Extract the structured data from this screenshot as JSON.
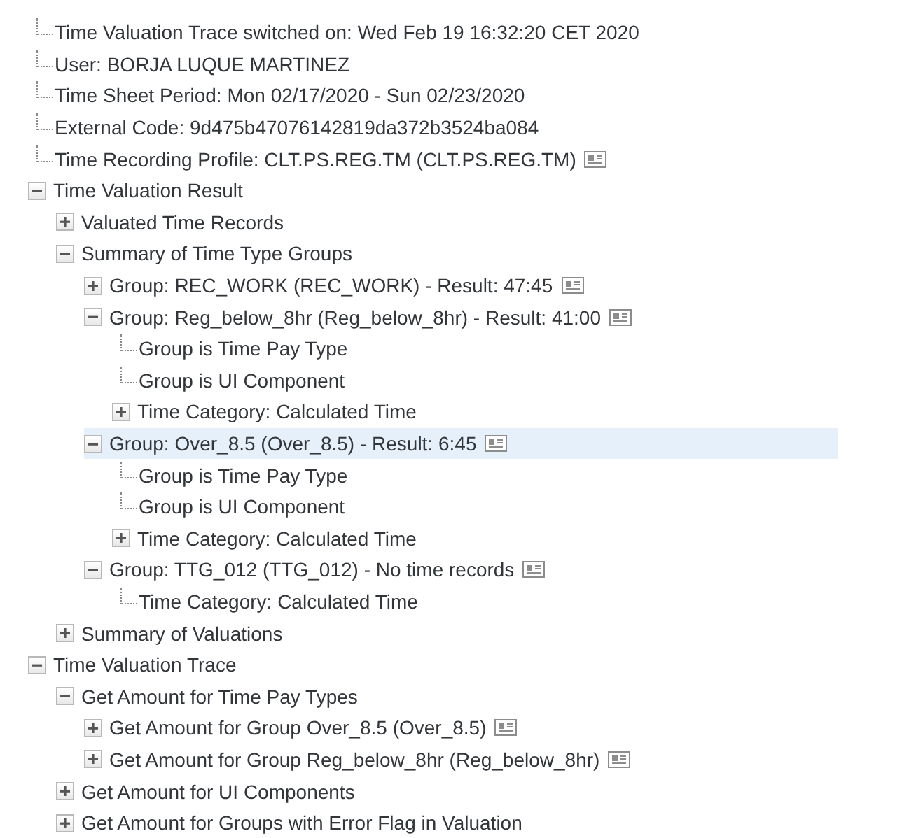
{
  "tree": [
    {
      "kind": "leaf",
      "label": "Time Valuation Trace switched on: Wed Feb 19 16:32:20 CET 2020",
      "selected": false,
      "details": false
    },
    {
      "kind": "leaf",
      "label": "User: BORJA LUQUE MARTINEZ",
      "selected": false,
      "details": false
    },
    {
      "kind": "leaf",
      "label": "Time Sheet Period: Mon 02/17/2020 - Sun 02/23/2020",
      "selected": false,
      "details": false
    },
    {
      "kind": "leaf",
      "label": "External Code: 9d475b47076142819da372b3524ba084",
      "selected": false,
      "details": false
    },
    {
      "kind": "leaf",
      "label": "Time Recording Profile: CLT.PS.REG.TM (CLT.PS.REG.TM)",
      "selected": false,
      "details": true
    },
    {
      "kind": "folder",
      "label": "Time Valuation Result",
      "expanded": true,
      "selected": false,
      "details": false,
      "children": [
        {
          "kind": "folder",
          "label": "Valuated Time Records",
          "expanded": false,
          "selected": false,
          "details": false
        },
        {
          "kind": "folder",
          "label": "Summary of Time Type Groups",
          "expanded": true,
          "selected": false,
          "details": false,
          "children": [
            {
              "kind": "folder",
              "label": "Group: REC_WORK (REC_WORK) - Result: 47:45",
              "expanded": false,
              "selected": false,
              "details": true
            },
            {
              "kind": "folder",
              "label": "Group: Reg_below_8hr (Reg_below_8hr) - Result: 41:00",
              "expanded": true,
              "selected": false,
              "details": true,
              "children": [
                {
                  "kind": "leaf",
                  "label": "Group is Time Pay Type",
                  "selected": false,
                  "details": false
                },
                {
                  "kind": "leaf",
                  "label": "Group is UI Component",
                  "selected": false,
                  "details": false
                },
                {
                  "kind": "folder",
                  "label": "Time Category: Calculated Time",
                  "expanded": false,
                  "selected": false,
                  "details": false
                }
              ]
            },
            {
              "kind": "folder",
              "label": "Group: Over_8.5 (Over_8.5) - Result: 6:45",
              "expanded": true,
              "selected": true,
              "details": true,
              "children": [
                {
                  "kind": "leaf",
                  "label": "Group is Time Pay Type",
                  "selected": false,
                  "details": false
                },
                {
                  "kind": "leaf",
                  "label": "Group is UI Component",
                  "selected": false,
                  "details": false
                },
                {
                  "kind": "folder",
                  "label": "Time Category: Calculated Time",
                  "expanded": false,
                  "selected": false,
                  "details": false
                }
              ]
            },
            {
              "kind": "folder",
              "label": "Group: TTG_012 (TTG_012) - No time records",
              "expanded": true,
              "selected": false,
              "details": true,
              "children": [
                {
                  "kind": "leaf",
                  "label": "Time Category: Calculated Time",
                  "selected": false,
                  "details": false
                }
              ]
            }
          ]
        },
        {
          "kind": "folder",
          "label": "Summary of Valuations",
          "expanded": false,
          "selected": false,
          "details": false
        }
      ]
    },
    {
      "kind": "folder",
      "label": "Time Valuation Trace",
      "expanded": true,
      "selected": false,
      "details": false,
      "children": [
        {
          "kind": "folder",
          "label": "Get Amount for Time Pay Types",
          "expanded": true,
          "selected": false,
          "details": false,
          "children": [
            {
              "kind": "folder",
              "label": "Get Amount for Group Over_8.5 (Over_8.5)",
              "expanded": false,
              "selected": false,
              "details": true
            },
            {
              "kind": "folder",
              "label": "Get Amount for Group Reg_below_8hr (Reg_below_8hr)",
              "expanded": false,
              "selected": false,
              "details": true
            }
          ]
        },
        {
          "kind": "folder",
          "label": "Get Amount for UI Components",
          "expanded": false,
          "selected": false,
          "details": false
        },
        {
          "kind": "folder",
          "label": "Get Amount for Groups with Error Flag in Valuation",
          "expanded": false,
          "selected": false,
          "details": false
        }
      ]
    }
  ]
}
